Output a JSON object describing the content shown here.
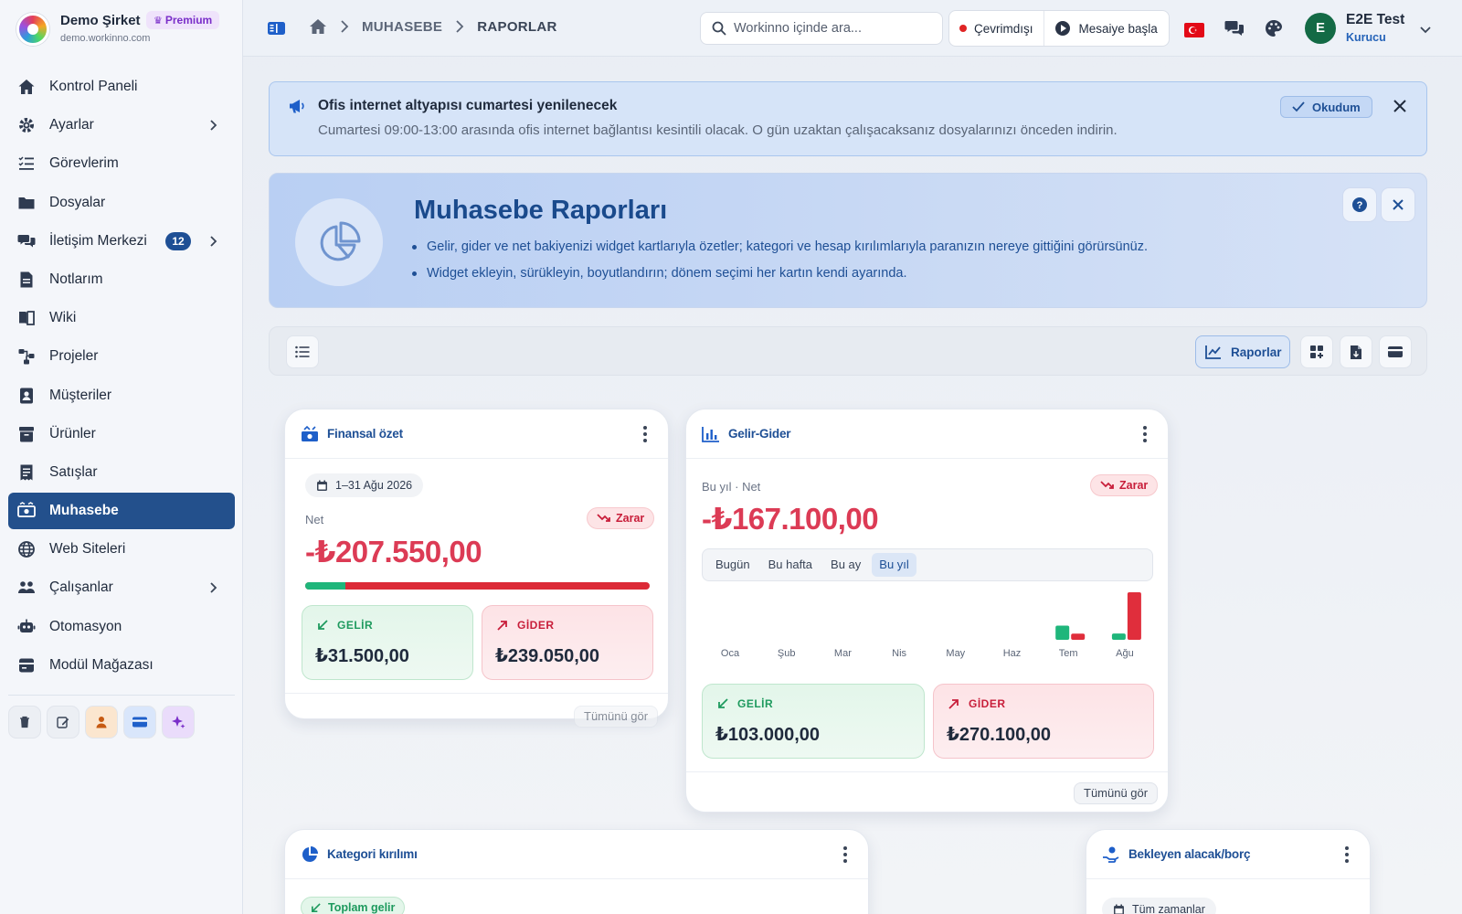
{
  "brand": {
    "name": "Demo Şirket",
    "badge": "Premium",
    "url": "demo.workinno.com"
  },
  "sidebar": {
    "items": [
      {
        "label": "Kontrol Paneli",
        "icon": "home-icon"
      },
      {
        "label": "Ayarlar",
        "icon": "gear-icon",
        "chevron": true
      },
      {
        "label": "Görevlerim",
        "icon": "tasks-icon"
      },
      {
        "label": "Dosyalar",
        "icon": "folder-icon"
      },
      {
        "label": "İletişim Merkezi",
        "icon": "chat-icon",
        "count": "12",
        "chevron": true
      },
      {
        "label": "Notlarım",
        "icon": "note-icon"
      },
      {
        "label": "Wiki",
        "icon": "book-icon"
      },
      {
        "label": "Projeler",
        "icon": "project-icon"
      },
      {
        "label": "Müşteriler",
        "icon": "contact-icon"
      },
      {
        "label": "Ürünler",
        "icon": "archive-icon"
      },
      {
        "label": "Satışlar",
        "icon": "receipt-icon"
      },
      {
        "label": "Muhasebe",
        "icon": "money-icon",
        "active": true
      },
      {
        "label": "Web Siteleri",
        "icon": "globe-icon"
      },
      {
        "label": "Çalışanlar",
        "icon": "people-icon",
        "chevron": true
      },
      {
        "label": "Otomasyon",
        "icon": "robot-icon"
      },
      {
        "label": "Modül Mağazası",
        "icon": "store-icon"
      }
    ]
  },
  "topbar": {
    "breadcrumb": [
      "MUHASEBE",
      "RAPORLAR"
    ],
    "search_placeholder": "Workinno içinde ara...",
    "status_offline": "Çevrimdışı",
    "start_shift": "Mesaiye başla",
    "user_initial": "E",
    "user_name": "E2E Test",
    "user_role": "Kurucu"
  },
  "announcement": {
    "title": "Ofis internet altyapısı cumartesi yenilenecek",
    "body": "Cumartesi 09:00-13:00 arasında ofis internet bağlantısı kesintili olacak. O gün uzaktan çalışacaksanız dosyalarınızı önceden indirin.",
    "ack_label": "Okudum"
  },
  "hero": {
    "title": "Muhasebe Raporları",
    "bullets": [
      "Gelir, gider ve net bakiyenizi widget kartlarıyla özetler; kategori ve hesap kırılımlarıyla paranızın nereye gittiğini görürsünüz.",
      "Widget ekleyin, sürükleyin, boyutlandırın; dönem seçimi her kartın kendi ayarında."
    ]
  },
  "toolbar": {
    "reports_label": "Raporlar"
  },
  "finance_card": {
    "title": "Finansal özet",
    "date_range": "1–31 Ağu 2026",
    "net_label": "Net",
    "badge": "Zarar",
    "net_value": "-₺207.550,00",
    "income_ratio": 0.116,
    "income_label": "GELİR",
    "income_value": "₺31.500,00",
    "expense_label": "GİDER",
    "expense_value": "₺239.050,00",
    "see_all": "Tümünü gör"
  },
  "income_card": {
    "title": "Gelir-Gider",
    "period_label": "Bu yıl · Net",
    "badge": "Zarar",
    "net_value": "-₺167.100,00",
    "tabs": [
      "Bugün",
      "Bu hafta",
      "Bu ay",
      "Bu yıl"
    ],
    "active_tab": 3,
    "income_label": "GELİR",
    "income_value": "₺103.000,00",
    "expense_label": "GİDER",
    "expense_value": "₺270.100,00",
    "see_all": "Tümünü gör"
  },
  "chart_data": {
    "type": "bar",
    "categories": [
      "Oca",
      "Şub",
      "Mar",
      "Nis",
      "May",
      "Haz",
      "Tem",
      "Ağu"
    ],
    "series": [
      {
        "name": "GELİR",
        "color": "#1fb67b",
        "values": [
          0,
          0,
          0,
          0,
          0,
          0,
          71500,
          31500
        ]
      },
      {
        "name": "GİDER",
        "color": "#e02e3c",
        "values": [
          0,
          0,
          0,
          0,
          0,
          0,
          31050,
          239050
        ]
      }
    ],
    "ylim": [
      0,
      239050
    ],
    "grid": false,
    "legend": "none"
  },
  "category_card": {
    "title": "Kategori kırılımı",
    "chip": "Toplam gelir"
  },
  "pending_card": {
    "title": "Bekleyen alacak/borç",
    "chip": "Tüm zamanlar"
  },
  "colors": {
    "accent": "#1e4f95",
    "active_nav": "#23508c",
    "income": "#1fb67b",
    "expense": "#e02e3c",
    "loss": "#dc3b55"
  }
}
